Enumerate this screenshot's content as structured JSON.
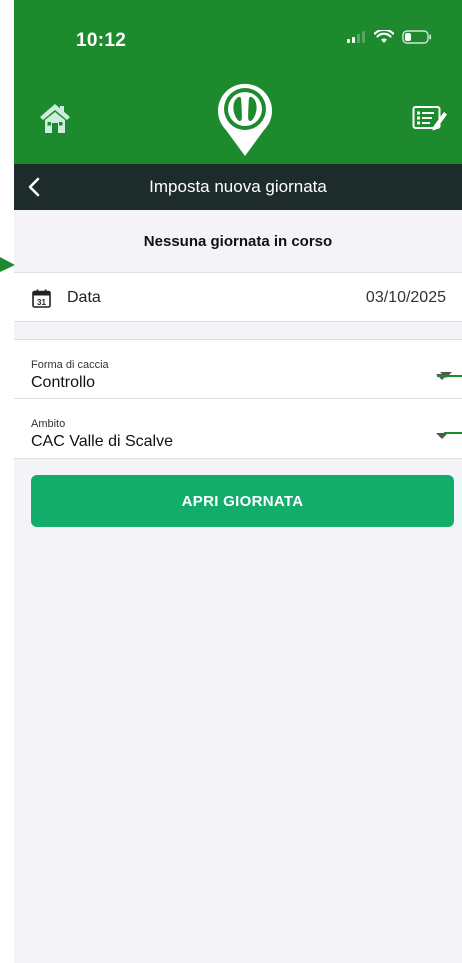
{
  "status_bar": {
    "time": "10:12"
  },
  "header": {
    "title": "Imposta nuova giornata"
  },
  "status_message": "Nessuna giornata in corso",
  "date_row": {
    "label": "Data",
    "value": "03/10/2025",
    "calendar_day": "31"
  },
  "fields": [
    {
      "label": "Forma di caccia",
      "value": "Controllo"
    },
    {
      "label": "Ambito",
      "value": "CAC Valle di Scalve"
    }
  ],
  "primary_button": {
    "label": "APRI GIORNATA"
  },
  "colors": {
    "header_green": "#1e8a2e",
    "title_bar": "#1d2b2a",
    "button_green": "#12ad6b",
    "page_bg": "#f4f4f8"
  },
  "icons": [
    "home-icon",
    "app-logo-icon",
    "notes-icon",
    "back-chevron-icon",
    "calendar-icon",
    "dropdown-caret-icon"
  ]
}
